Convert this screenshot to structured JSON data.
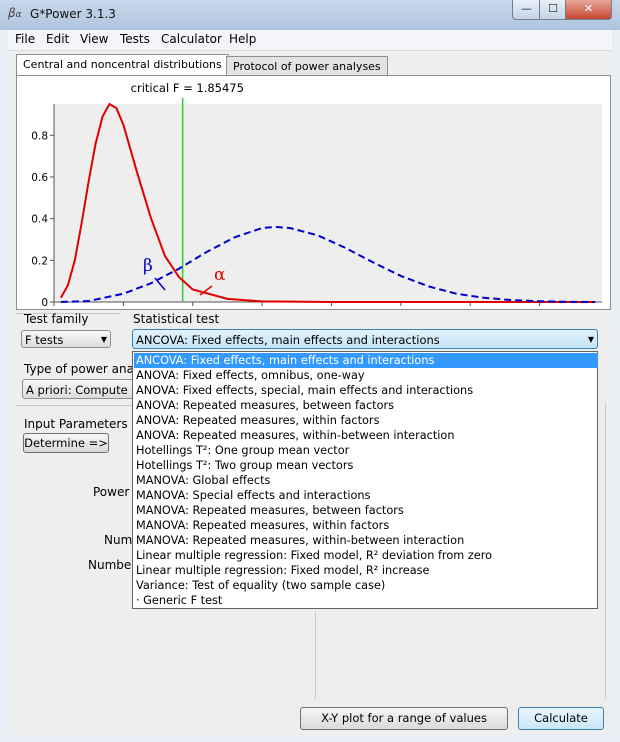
{
  "window": {
    "title": "G*Power 3.1.3",
    "icon": "app-icon",
    "controls": {
      "minimize": "—",
      "maximize": "☐",
      "close": "✕"
    }
  },
  "menu": [
    "File",
    "Edit",
    "View",
    "Tests",
    "Calculator",
    "Help"
  ],
  "tabs": [
    "Central and noncentral distributions",
    "Protocol of power analyses"
  ],
  "plot": {
    "critical_label": "critical F = 1.85475",
    "beta_symbol": "β",
    "alpha_symbol": "α",
    "colors": {
      "central": "#e00000",
      "noncentral": "#0000cc",
      "critical": "#33cc33"
    }
  },
  "chart_data": {
    "type": "line",
    "x_ticks": [
      "0",
      "1",
      "2",
      "3",
      "4",
      "5",
      "6",
      "7"
    ],
    "y_ticks": [
      "0",
      "0.2",
      "0.4",
      "0.6",
      "0.8"
    ],
    "xlim": [
      0,
      7.9
    ],
    "ylim": [
      0,
      0.95
    ],
    "critical_x": 1.85475,
    "series": [
      {
        "style": "solid",
        "color": "#e00000",
        "x": [
          0.1,
          0.2,
          0.3,
          0.4,
          0.5,
          0.6,
          0.7,
          0.8,
          0.9,
          1.0,
          1.2,
          1.4,
          1.6,
          1.8,
          2.0,
          2.5,
          3.0,
          4.0,
          7.8
        ],
        "y": [
          0.02,
          0.08,
          0.2,
          0.38,
          0.58,
          0.76,
          0.89,
          0.95,
          0.93,
          0.85,
          0.62,
          0.4,
          0.22,
          0.12,
          0.06,
          0.015,
          0.003,
          0,
          0
        ]
      },
      {
        "style": "dashed",
        "color": "#0000cc",
        "x": [
          0.1,
          0.5,
          1.0,
          1.4,
          1.8,
          2.2,
          2.6,
          3.0,
          3.2,
          3.4,
          3.8,
          4.2,
          4.6,
          5.0,
          5.4,
          5.8,
          6.2,
          6.6,
          7.0,
          7.4,
          7.8
        ],
        "y": [
          0,
          0.005,
          0.04,
          0.09,
          0.16,
          0.24,
          0.31,
          0.355,
          0.36,
          0.355,
          0.32,
          0.26,
          0.19,
          0.125,
          0.075,
          0.04,
          0.02,
          0.009,
          0.004,
          0.001,
          0
        ]
      }
    ]
  },
  "labels": {
    "test_family": "Test family",
    "statistical_test": "Statistical test",
    "type_of_power": "Type of power analy",
    "input_parameters": "Input Parameters",
    "power": "Power (",
    "numb": "Numb",
    "number": "Number"
  },
  "test_family_value": "F tests",
  "statistical_test_value": "ANCOVA: Fixed effects, main effects and interactions",
  "power_analysis_value": "A priori: Compute r",
  "determine_button": "Determine =>",
  "dropdown_options": [
    "ANCOVA: Fixed effects, main effects and interactions",
    "ANOVA: Fixed effects, omnibus, one-way",
    "ANOVA: Fixed effects, special, main effects and interactions",
    "ANOVA: Repeated measures, between factors",
    "ANOVA: Repeated measures, within factors",
    "ANOVA: Repeated measures, within-between interaction",
    "Hotellings T²: One group mean vector",
    "Hotellings T²: Two group mean vectors",
    "MANOVA: Global effects",
    "MANOVA: Special effects and interactions",
    "MANOVA: Repeated measures, between factors",
    "MANOVA: Repeated measures, within factors",
    "MANOVA: Repeated measures, within-between interaction",
    "Linear multiple regression: Fixed model, R² deviation from zero",
    "Linear multiple regression: Fixed model, R² increase",
    "Variance: Test of equality (two sample case)",
    "· Generic F test"
  ],
  "buttons": {
    "xy_plot": "X-Y plot for a range of values",
    "calculate": "Calculate"
  },
  "watermark": "SOFTPEDIA"
}
